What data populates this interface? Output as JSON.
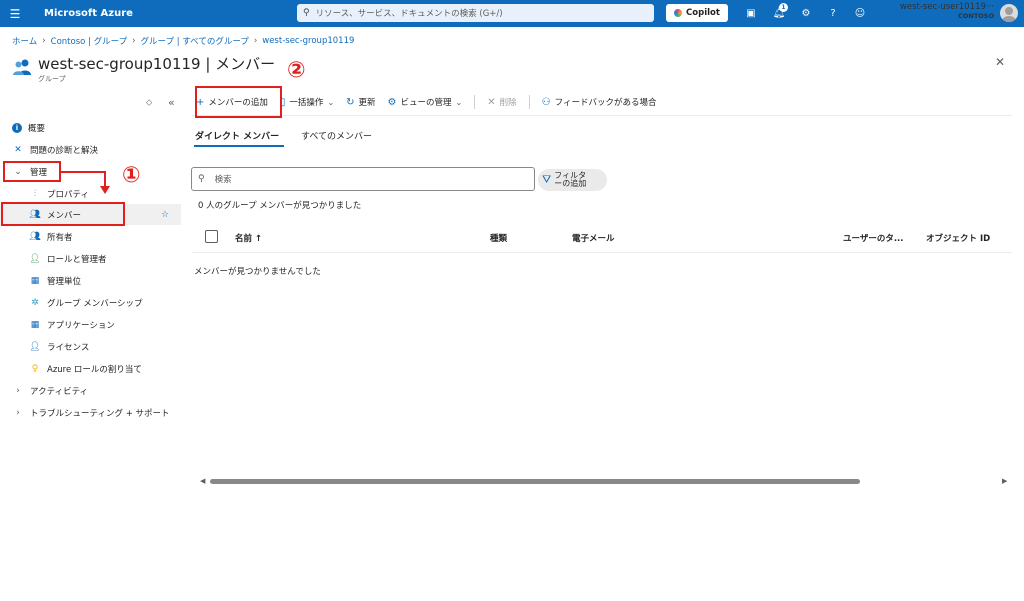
{
  "topbar": {
    "brand": "Microsoft Azure",
    "search_placeholder": "リソース、サービス、ドキュメントの検索 (G+/)",
    "copilot_label": "Copilot",
    "notification_count": "1",
    "user_name": "west-sec-user10119···",
    "tenant": "CONTOSO"
  },
  "breadcrumb": [
    "ホーム",
    "Contoso | グループ",
    "グループ | すべてのグループ",
    "west-sec-group10119"
  ],
  "page": {
    "title": "west-sec-group10119 | メンバー",
    "subtitle": "グループ"
  },
  "sidebar": {
    "items": [
      {
        "label": "概要"
      },
      {
        "label": "問題の診断と解決"
      },
      {
        "label": "管理"
      },
      {
        "label": "プロパティ"
      },
      {
        "label": "メンバー"
      },
      {
        "label": "所有者"
      },
      {
        "label": "ロールと管理者"
      },
      {
        "label": "管理単位"
      },
      {
        "label": "グループ メンバーシップ"
      },
      {
        "label": "アプリケーション"
      },
      {
        "label": "ライセンス"
      },
      {
        "label": "Azure ロールの割り当て"
      },
      {
        "label": "アクティビティ"
      },
      {
        "label": "トラブルシューティング + サポート"
      }
    ]
  },
  "toolbar": {
    "add_member": "メンバーの追加",
    "bulk": "一括操作",
    "refresh": "更新",
    "manage_view": "ビューの管理",
    "delete": "削除",
    "feedback": "フィードバックがある場合"
  },
  "tabs": {
    "direct": "ダイレクト メンバー",
    "all": "すべてのメンバー"
  },
  "search": {
    "placeholder": "検索"
  },
  "filter": {
    "line1": "フィルタ",
    "line2": "ーの追加"
  },
  "found_text": "0 人のグループ メンバーが見つかりました",
  "table": {
    "columns": [
      "名前 ↑",
      "種類",
      "電子メール",
      "ユーザーのタ...",
      "オブジェクト ID"
    ],
    "empty": "メンバーが見つかりませんでした"
  },
  "annotations": {
    "step1": "①",
    "step2": "②"
  },
  "colors": {
    "accent": "#0f6cbd",
    "annotation": "#e0201c"
  }
}
